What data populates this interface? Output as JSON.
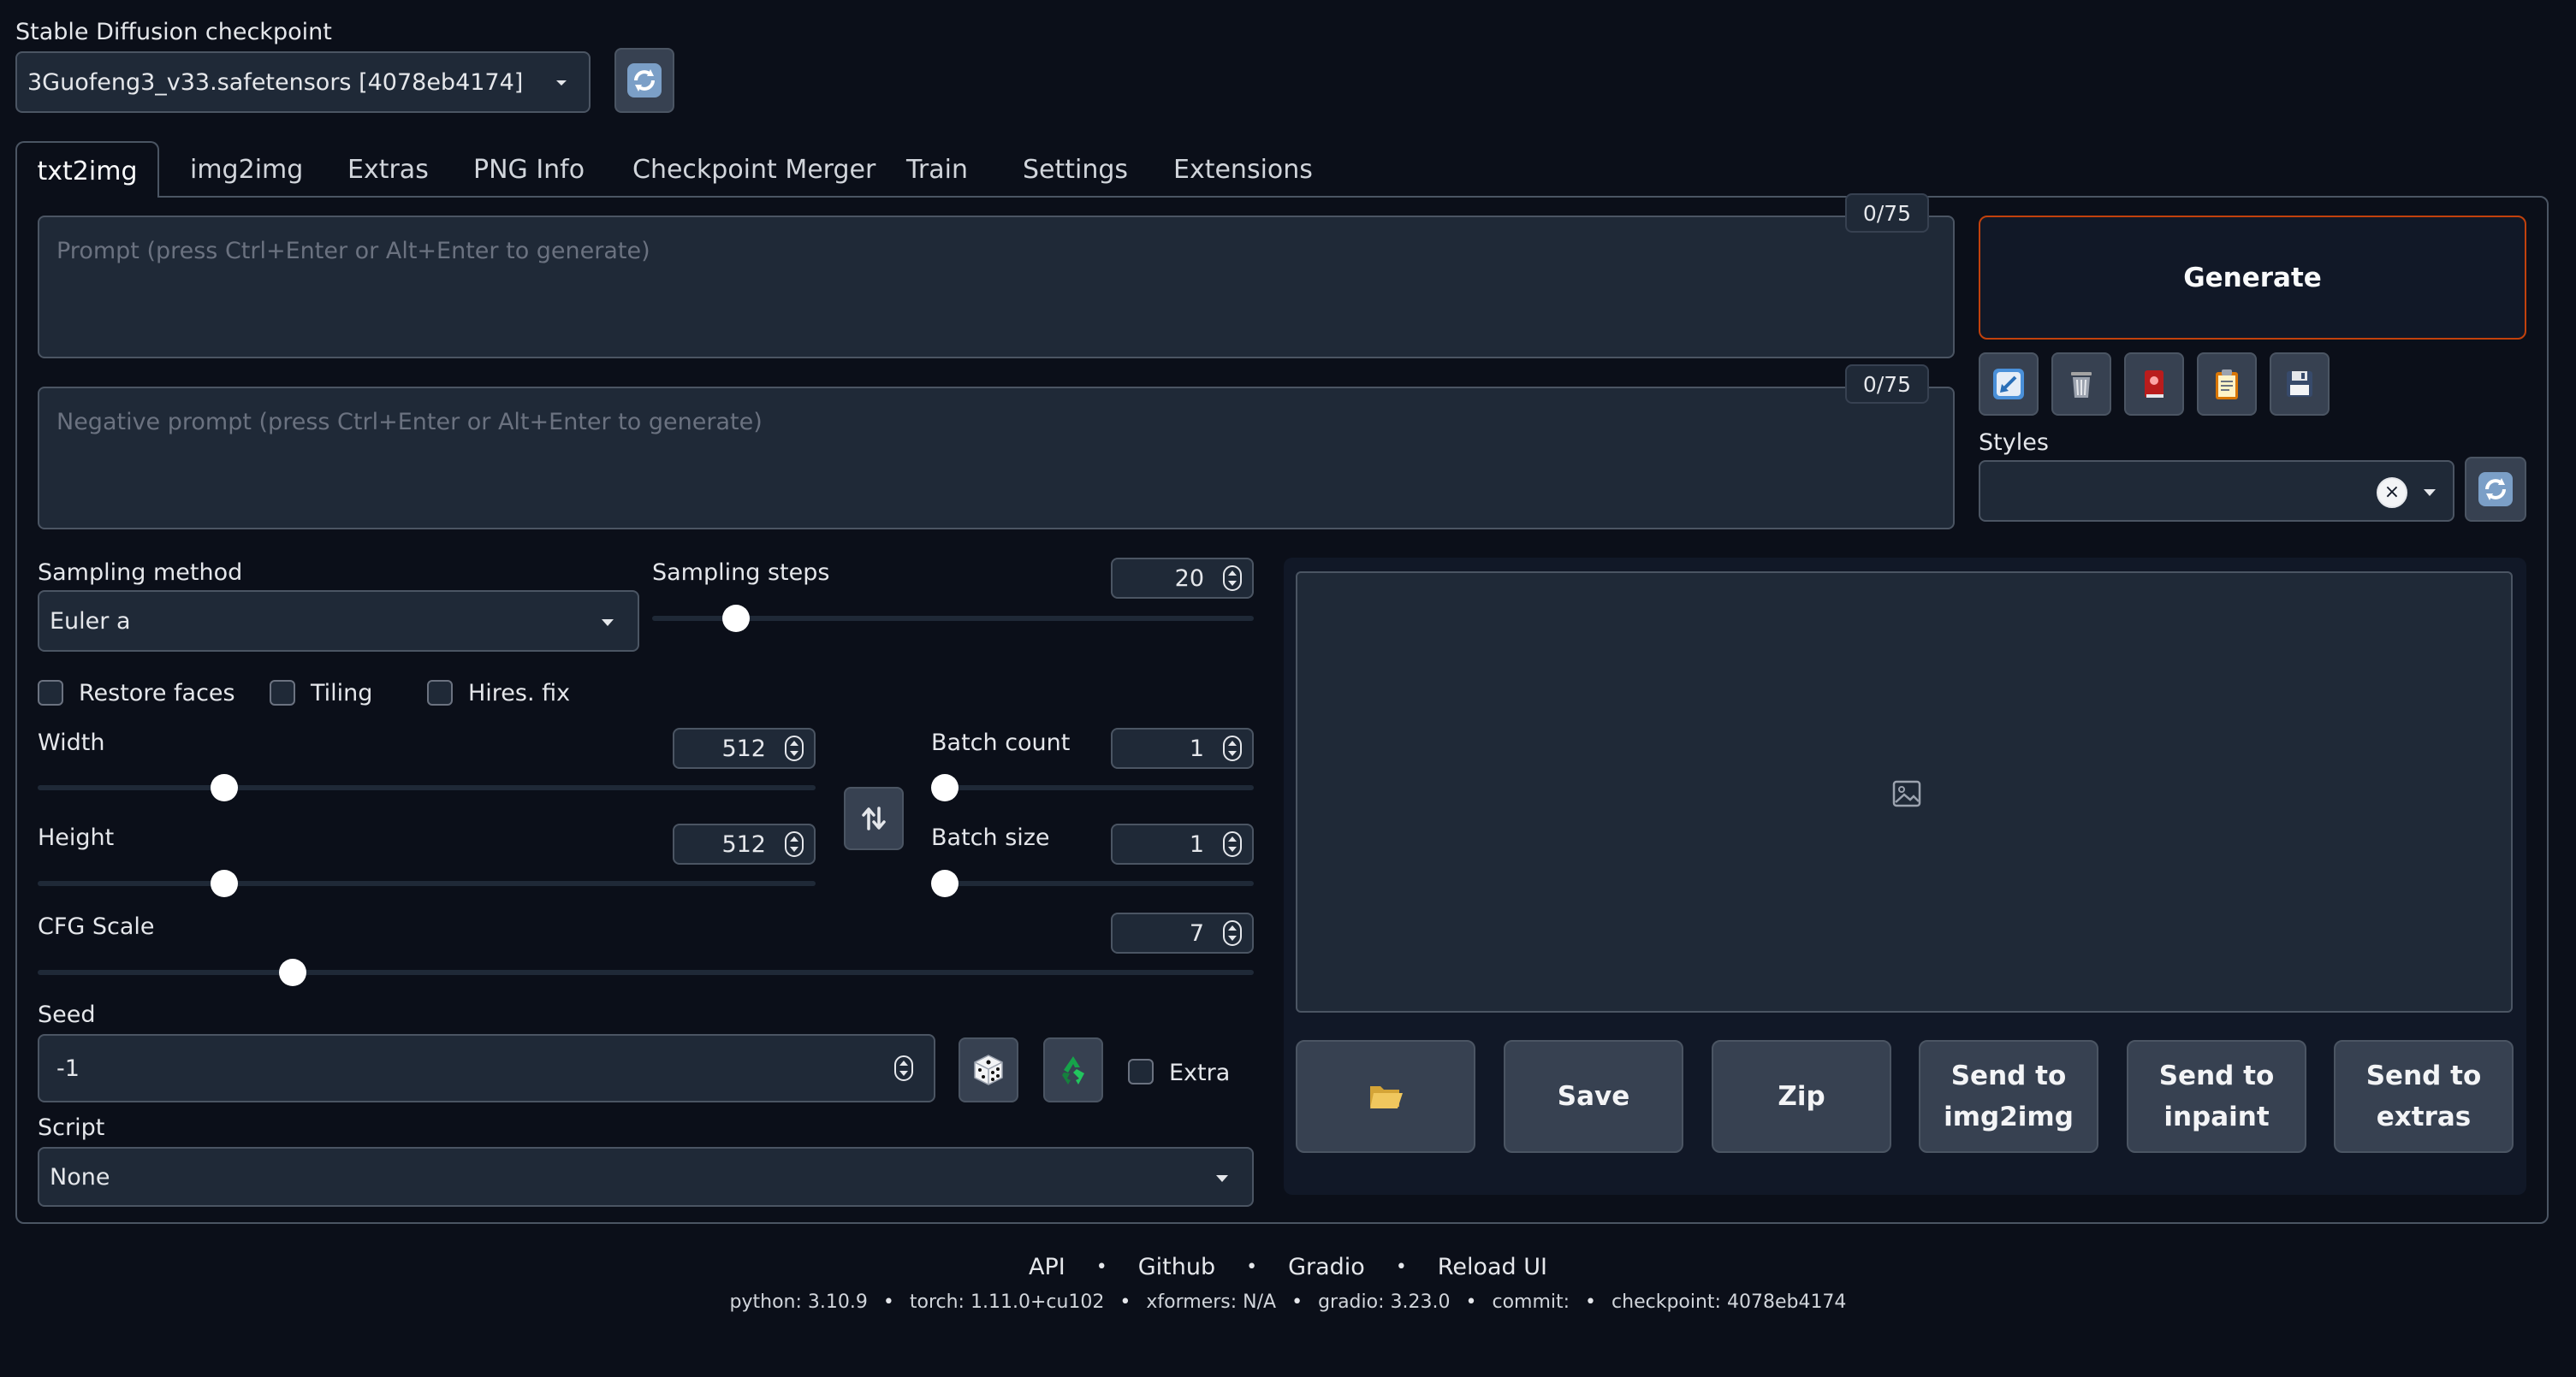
{
  "checkpoint": {
    "label": "Stable Diffusion checkpoint",
    "value": "3Guofeng3_v33.safetensors [4078eb4174]",
    "refresh_icon": "refresh-icon"
  },
  "tabs": [
    {
      "label": "txt2img",
      "active": true
    },
    {
      "label": "img2img"
    },
    {
      "label": "Extras"
    },
    {
      "label": "PNG Info"
    },
    {
      "label": "Checkpoint Merger"
    },
    {
      "label": "Train"
    },
    {
      "label": "Settings"
    },
    {
      "label": "Extensions"
    }
  ],
  "prompt": {
    "placeholder": "Prompt (press Ctrl+Enter or Alt+Enter to generate)",
    "counter": "0/75"
  },
  "negative_prompt": {
    "placeholder": "Negative prompt (press Ctrl+Enter or Alt+Enter to generate)",
    "counter": "0/75"
  },
  "generate": {
    "label": "Generate"
  },
  "tool_icons": [
    "arrow-icon",
    "trash-icon",
    "red-book-icon",
    "clipboard-icon",
    "floppy-disk-icon"
  ],
  "styles": {
    "label": "Styles",
    "value": ""
  },
  "sampling": {
    "method_label": "Sampling method",
    "method_value": "Euler a",
    "steps_label": "Sampling steps",
    "steps_value": "20",
    "steps_fraction": 0.14
  },
  "checkboxes": {
    "restore_faces": "Restore faces",
    "tiling": "Tiling",
    "hires": "Hires. fix"
  },
  "width": {
    "label": "Width",
    "value": "512",
    "fraction": 0.24
  },
  "height": {
    "label": "Height",
    "value": "512",
    "fraction": 0.24
  },
  "batch_count": {
    "label": "Batch count",
    "value": "1",
    "fraction": 0.0
  },
  "batch_size": {
    "label": "Batch size",
    "value": "1",
    "fraction": 0.0
  },
  "cfg": {
    "label": "CFG Scale",
    "value": "7",
    "fraction": 0.21
  },
  "seed": {
    "label": "Seed",
    "value": "-1",
    "extra_label": "Extra"
  },
  "script": {
    "label": "Script",
    "value": "None"
  },
  "output_buttons": {
    "save": "Save",
    "zip": "Zip",
    "img2img_l1": "Send to",
    "img2img_l2": "img2img",
    "inpaint_l1": "Send to",
    "inpaint_l2": "inpaint",
    "extras_l1": "Send to",
    "extras_l2": "extras"
  },
  "footer": {
    "links": [
      "API",
      "Github",
      "Gradio",
      "Reload UI"
    ],
    "info": {
      "python": "python: 3.10.9",
      "torch": "torch: 1.11.0+cu102",
      "xformers": "xformers: N/A",
      "gradio": "gradio: 3.23.0",
      "commit": "commit:",
      "checkpoint": "checkpoint: 4078eb4174"
    }
  },
  "colors": {
    "background": "#0b0f19",
    "panel": "#1f2937",
    "generate_border": "#c2410c"
  }
}
